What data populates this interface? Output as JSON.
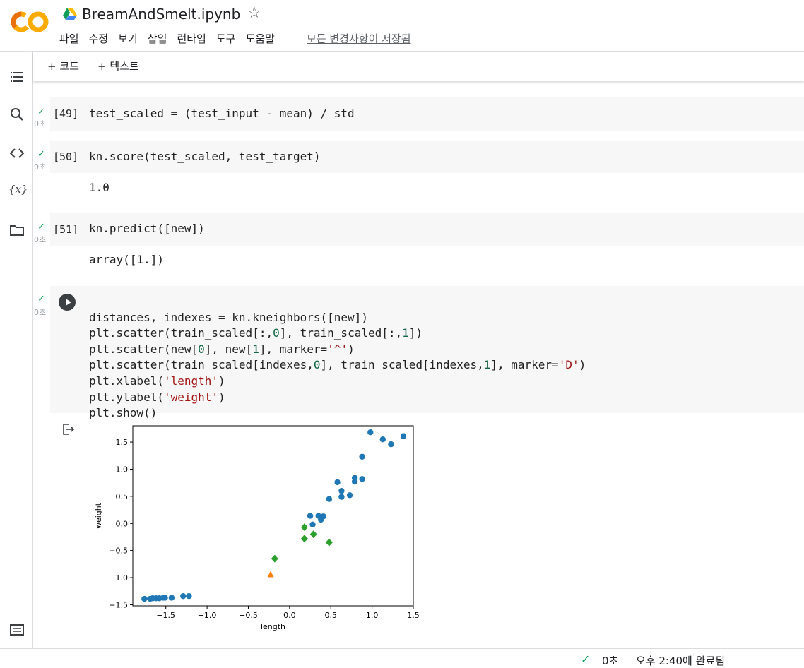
{
  "app": {
    "filename": "BreamAndSmelt.ipynb",
    "menu": [
      "파일",
      "수정",
      "보기",
      "삽입",
      "런타임",
      "도구",
      "도움말"
    ],
    "save_status": "모든 변경사항이 저장됨"
  },
  "toolbar": {
    "add_code": "+ 코드",
    "add_text": "+ 텍스트"
  },
  "cells": [
    {
      "count": "[49]",
      "secs": "0초",
      "code": "test_scaled = (test_input - mean) / std"
    },
    {
      "count": "[50]",
      "secs": "0초",
      "code": "kn.score(test_scaled, test_target)",
      "output": "1.0"
    },
    {
      "count": "[51]",
      "secs": "0초",
      "code": "kn.predict([new])",
      "output": "array([1.])"
    },
    {
      "secs": "0초",
      "code_lines": [
        "distances, indexes = kn.kneighbors([new])",
        "plt.scatter(train_scaled[:,0], train_scaled[:,1])",
        "plt.scatter(new[0], new[1], marker='^')",
        "plt.scatter(train_scaled[indexes,0], train_scaled[indexes,1], marker='D')",
        "plt.xlabel('length')",
        "plt.ylabel('weight')",
        "plt.show()"
      ]
    }
  ],
  "status": {
    "check": "✓",
    "secs": "0초",
    "done": "오후 2:40에 완료됨"
  },
  "chart_data": {
    "type": "scatter",
    "xlabel": "length",
    "ylabel": "weight",
    "xlim": [
      -1.9,
      1.5
    ],
    "ylim": [
      -1.52,
      1.8
    ],
    "xticks": [
      -1.5,
      -1.0,
      -0.5,
      0.0,
      0.5,
      1.0,
      1.5
    ],
    "yticks": [
      -1.5,
      -1.0,
      -0.5,
      0.0,
      0.5,
      1.0,
      1.5
    ],
    "xtick_labels": [
      "−1.5",
      "−1.0",
      "−0.5",
      "0.0",
      "0.5",
      "1.0",
      "1.5"
    ],
    "ytick_labels": [
      "−1.5",
      "−1.0",
      "−0.5",
      "0.0",
      "0.5",
      "1.0",
      "1.5"
    ],
    "series": [
      {
        "marker": "circle",
        "color": "#1f77b4",
        "points": [
          [
            -1.76,
            -1.39
          ],
          [
            -1.69,
            -1.39
          ],
          [
            -1.66,
            -1.38
          ],
          [
            -1.62,
            -1.38
          ],
          [
            -1.58,
            -1.38
          ],
          [
            -1.53,
            -1.37
          ],
          [
            -1.51,
            -1.37
          ],
          [
            -1.43,
            -1.37
          ],
          [
            -1.29,
            -1.34
          ],
          [
            -1.22,
            -1.34
          ],
          [
            0.25,
            0.14
          ],
          [
            0.28,
            -0.02
          ],
          [
            0.35,
            0.14
          ],
          [
            0.38,
            0.07
          ],
          [
            0.41,
            0.13
          ],
          [
            0.48,
            0.45
          ],
          [
            0.58,
            0.76
          ],
          [
            0.63,
            0.49
          ],
          [
            0.63,
            0.6
          ],
          [
            0.73,
            0.52
          ],
          [
            0.79,
            0.77
          ],
          [
            0.79,
            0.84
          ],
          [
            0.88,
            0.82
          ],
          [
            0.88,
            1.23
          ],
          [
            0.98,
            1.68
          ],
          [
            1.13,
            1.55
          ],
          [
            1.23,
            1.46
          ],
          [
            1.38,
            1.61
          ]
        ]
      },
      {
        "marker": "triangle",
        "color": "#ff7f0e",
        "points": [
          [
            -0.23,
            -0.94
          ]
        ]
      },
      {
        "marker": "diamond",
        "color": "#2ca02c",
        "points": [
          [
            -0.18,
            -0.65
          ],
          [
            0.18,
            -0.07
          ],
          [
            0.18,
            -0.28
          ],
          [
            0.29,
            -0.2
          ],
          [
            0.48,
            -0.35
          ]
        ]
      }
    ]
  }
}
